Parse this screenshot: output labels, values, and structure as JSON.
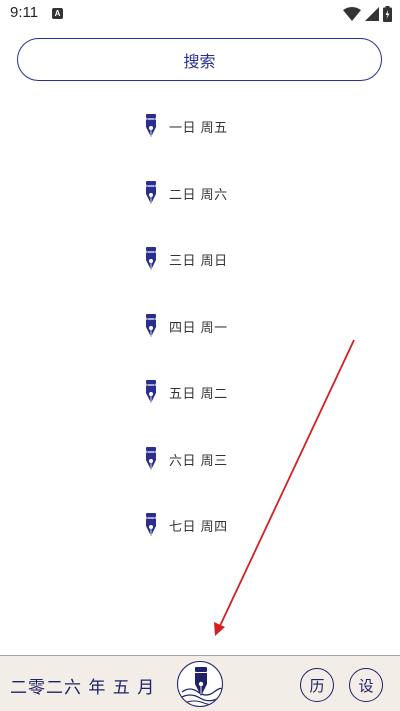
{
  "status": {
    "time": "9:11",
    "notif_letter": "A"
  },
  "search": {
    "label": "搜索"
  },
  "days": [
    {
      "label": "一日 周五"
    },
    {
      "label": "二日 周六"
    },
    {
      "label": "三日 周日"
    },
    {
      "label": "四日 周一"
    },
    {
      "label": "五日 周二"
    },
    {
      "label": "六日 周三"
    },
    {
      "label": "七日 周四"
    }
  ],
  "bottom": {
    "date": "二零二六 年 五 月",
    "history_label": "历",
    "settings_label": "设"
  },
  "colors": {
    "accent": "#2a2f8f",
    "annotation": "#d42020",
    "bar_bg": "#f3ede8"
  },
  "icons": {
    "day_item": "fountain-pen-icon",
    "logo": "pen-emblem-icon"
  }
}
